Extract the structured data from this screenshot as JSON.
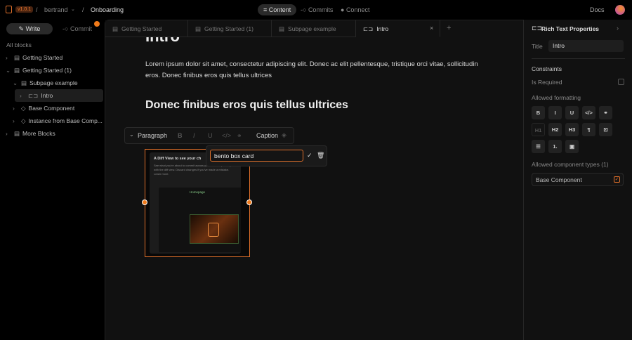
{
  "topbar": {
    "version": "v1.0.1",
    "user": "bertrand",
    "project": "Onboarding",
    "nav": [
      "Content",
      "Commits",
      "Connect"
    ],
    "docs": "Docs"
  },
  "sidebar": {
    "write": "Write",
    "commit": "Commit",
    "all_blocks": "All blocks",
    "items": [
      {
        "label": "Getting Started",
        "level": 0,
        "icon": "document-icon",
        "chevron": "right"
      },
      {
        "label": "Getting Started (1)",
        "level": 0,
        "icon": "document-icon",
        "chevron": "down"
      },
      {
        "label": "Subpage example",
        "level": 1,
        "icon": "document-icon",
        "chevron": "down"
      },
      {
        "label": "Intro",
        "level": 2,
        "icon": "rich-text-icon",
        "chevron": "right",
        "selected": true
      },
      {
        "label": "Base Component",
        "level": 1,
        "icon": "diamond-icon",
        "chevron": "right"
      },
      {
        "label": "Instance from Base Comp...",
        "level": 1,
        "icon": "diamond-icon",
        "chevron": "right"
      },
      {
        "label": "More Blocks",
        "level": 0,
        "icon": "document-icon",
        "chevron": "right"
      }
    ]
  },
  "tabs": [
    {
      "label": "Getting Started"
    },
    {
      "label": "Getting Started (1)"
    },
    {
      "label": "Subpage example"
    },
    {
      "label": "Intro",
      "active": true
    }
  ],
  "editor": {
    "title": "Intro",
    "paragraph": "Lorem ipsum dolor sit amet, consectetur adipiscing elit. Donec ac elit pellentesque, tristique orci vitae, sollicitudin eros. Donec finibus eros quis tellus ultrices",
    "heading": "Donec finibus eros quis tellus ultrices",
    "toolbar": {
      "block_type": "Paragraph",
      "caption": "Caption"
    },
    "image": {
      "title": "A Diff View to see your ch",
      "desc": "See what you're about to commit across your whole repository with the diff view. Discard changes if you've made a mistake. Learn more.",
      "inner_title": "Homepage"
    },
    "alt_input": "bento box card"
  },
  "panel": {
    "title": "Rich Text Properties",
    "title_label": "Title",
    "title_value": "Intro",
    "constraints": "Constraints",
    "is_required": "Is Required",
    "allowed_formatting": "Allowed formatting",
    "formats": [
      "B",
      "I",
      "U",
      "</>",
      "⚭",
      "H1",
      "H2",
      "H3",
      "¶",
      "⊡",
      "☰",
      "1.",
      "▣"
    ],
    "allowed_types": "Allowed component types (1)",
    "component": "Base Component"
  },
  "colors": {
    "accent": "#f07a1a",
    "bg": "#111111"
  }
}
